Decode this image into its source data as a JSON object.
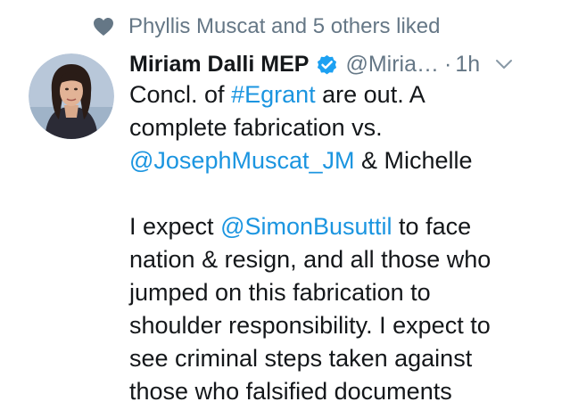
{
  "social_context": {
    "icon": "heart-icon",
    "text": "Phyllis Muscat and 5 others liked"
  },
  "tweet": {
    "author": {
      "display_name": "Miriam Dalli MEP",
      "verified": true,
      "handle": "@Miria…",
      "separator": "·",
      "timestamp": "1h",
      "avatar_icon": "avatar"
    },
    "lines": [
      [
        {
          "t": "Concl. of "
        },
        {
          "t": "#Egrant",
          "link": true,
          "name": "hashtag-egrant"
        },
        {
          "t": " are out. A"
        }
      ],
      [
        {
          "t": "complete fabrication vs."
        }
      ],
      [
        {
          "t": "@JosephMuscat_JM",
          "link": true,
          "name": "mention-josephmuscat"
        },
        {
          "t": " & Michelle"
        }
      ],
      [],
      [
        {
          "t": "I expect "
        },
        {
          "t": "@SimonBusuttil",
          "link": true,
          "name": "mention-simonbusuttil"
        },
        {
          "t": " to face"
        }
      ],
      [
        {
          "t": "nation & resign, and all those who"
        }
      ],
      [
        {
          "t": "jumped on this fabrication to"
        }
      ],
      [
        {
          "t": "shoulder responsibility. I expect to"
        }
      ],
      [
        {
          "t": "see criminal steps taken against"
        }
      ],
      [
        {
          "t": "those who falsified documents"
        }
      ]
    ]
  },
  "colors": {
    "link": "#1b95e0",
    "secondary_text": "#657786",
    "primary_text": "#14171a",
    "verified_badge": "#1da1f2"
  }
}
